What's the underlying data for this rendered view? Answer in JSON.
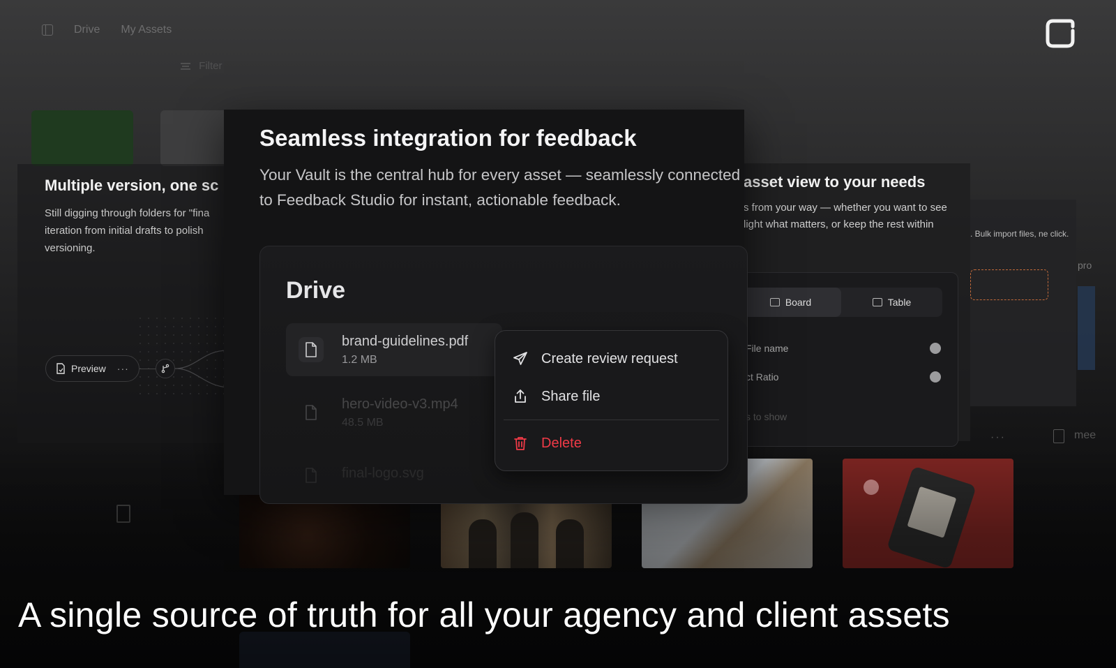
{
  "background": {
    "nav": {
      "drive": "Drive",
      "my_assets": "My Assets"
    },
    "filter_label": "Filter",
    "left_card": {
      "title": "Multiple version, one sc",
      "body": "Still digging through folders for \"fina iteration from initial drafts to polish versioning.",
      "preview_label": "Preview"
    },
    "right_card": {
      "title": "asset view to your needs",
      "body": "s from your way — whether you want to see light what matters, or keep the rest within",
      "tabs": {
        "board": "Board",
        "table": "Table"
      },
      "options": [
        "File name",
        "ct Ratio"
      ],
      "empty_text": "s to show"
    },
    "far_card": {
      "body": ". Bulk import files, ne click."
    },
    "far_edge_text": "pro",
    "edge_file_text": "mee"
  },
  "main_card": {
    "title": "Seamless integration for feedback",
    "lead": "Your Vault is the central hub for every asset — seamlessly connected to Feedback Studio for instant, actionable feedback.",
    "drive": {
      "title": "Drive",
      "files": [
        {
          "name": "brand-guidelines.pdf",
          "size": "1.2 MB"
        },
        {
          "name": "hero-video-v3.mp4",
          "size": "48.5 MB"
        },
        {
          "name": "final-logo.svg",
          "size": ""
        }
      ]
    },
    "context_menu": {
      "create_review": "Create review request",
      "share": "Share file",
      "delete": "Delete"
    }
  },
  "caption": "A single source of truth for all your agency and client assets",
  "colors": {
    "danger": "#f03a47",
    "accent_dashed": "#c26a3a"
  }
}
